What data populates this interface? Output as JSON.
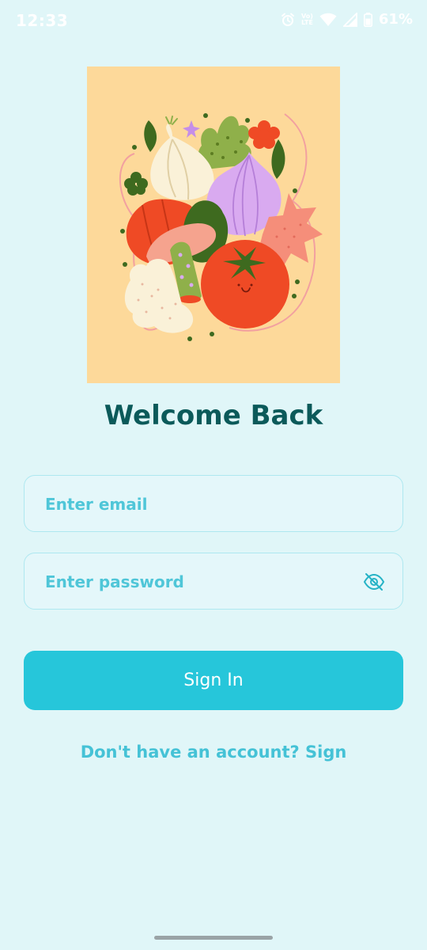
{
  "status_bar": {
    "time": "12:33",
    "network_label_top": "Vo)",
    "network_label_bottom": "LTE",
    "battery": "61%",
    "icons": [
      "alarm-icon",
      "volte-icon",
      "wifi-icon",
      "signal-icon",
      "battery-icon"
    ]
  },
  "hero": {
    "illustration": "vegetables-illustration",
    "background": "#fdd99a"
  },
  "login": {
    "title": "Welcome Back",
    "email_placeholder": "Enter email",
    "password_placeholder": "Enter password",
    "password_toggle_icon": "eye-off-icon",
    "sign_in_label": "Sign In",
    "signup_prompt": "Don't have an account? Sign"
  },
  "colors": {
    "background": "#e0f6f8",
    "title": "#0b5a5a",
    "accent": "#26c6da",
    "link": "#45c2d6",
    "field_border": "#aee8f0"
  }
}
